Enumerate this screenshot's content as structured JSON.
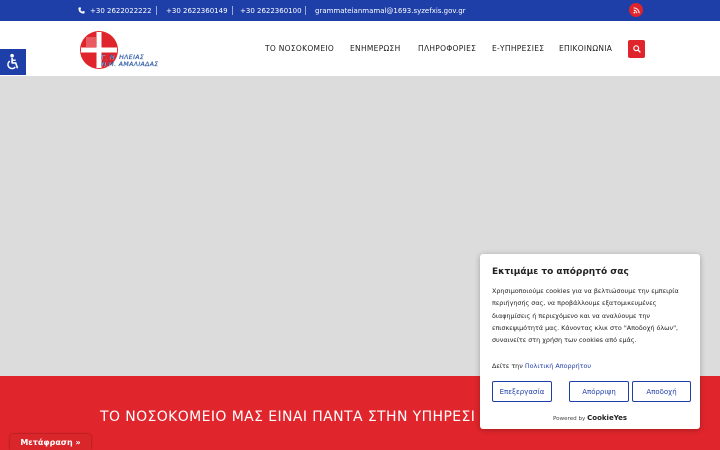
{
  "topbar": {
    "phones": [
      "+30 2622022222",
      "+30 2622360149",
      "+30 2622360100"
    ],
    "email": "grammateianmamal@1693.syzefxis.gov.gr",
    "icons": [
      "phone-icon",
      "mail-icon",
      "rss-icon"
    ]
  },
  "logo": {
    "line1": "Γ. Ν. ΗΛΕΙΑΣ",
    "line2": "Ν.Μ. ΑΜΑΛΙΑΔΑΣ"
  },
  "nav": {
    "items": [
      "ΤΟ ΝΟΣΟΚΟΜΕΙΟ",
      "ΕΝΗΜΕΡΩΣΗ",
      "ΠΛΗΡΟΦΟΡΙΕΣ",
      "Ε-ΥΠΗΡΕΣΙΕΣ",
      "ΕΠΙΚΟΙΝΩΝΙΑ"
    ]
  },
  "banner": {
    "text": "ΤΟ ΝΟΣΟΚΟΜΕΙΟ ΜΑΣ ΕΙΝΑΙ ΠΑΝΤΑ ΣΤΗΝ ΥΠΗΡΕΣΙ"
  },
  "translate": {
    "label": "Μετάφραση »"
  },
  "cookie": {
    "title": "Εκτιμάμε το απόρρητό σας",
    "body": "Χρησιμοποιούμε cookies για να βελτιώσουμε την εμπειρία περιήγησής σας, να προβάλλουμε εξατομικευμένες διαφημίσεις ή περιεχόμενο και να αναλύουμε την επισκεψιμότητά μας. Κάνοντας κλικ στο \"Αποδοχή όλων\", συναινείτε στη χρήση των cookies από εμάς.",
    "policy_prefix": "Δείτε την",
    "policy_link": "Πολιτική Απορρήτου",
    "buttons": {
      "customize": "Επεξεργασία",
      "reject": "Απόρριψη",
      "accept": "Αποδοχή"
    },
    "powered_by": "Powered by",
    "brand": "CookieYes"
  },
  "colors": {
    "primary_blue": "#1f3fa8",
    "accent_red": "#e0242b",
    "hero_gray": "#dcdcdc"
  }
}
